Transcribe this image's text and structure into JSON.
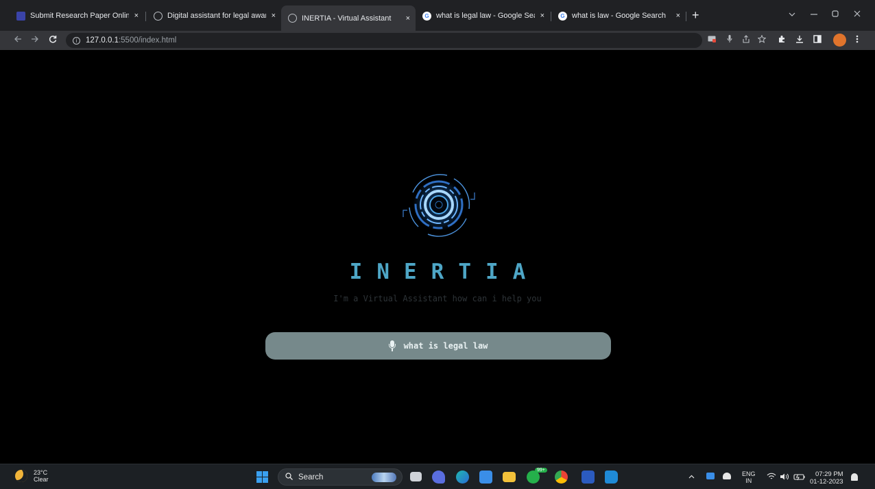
{
  "browser": {
    "tabs": [
      {
        "title": "Submit Research Paper Online -",
        "icon": "paper-icon",
        "active": false
      },
      {
        "title": "Digital assistant for legal awaren",
        "icon": "globe-icon",
        "active": false
      },
      {
        "title": "INERTIA - Virtual Assistant",
        "icon": "globe-icon",
        "active": true
      },
      {
        "title": "what is legal law - Google Searc",
        "icon": "google-icon",
        "active": false
      },
      {
        "title": "what is law - Google Search",
        "icon": "google-icon",
        "active": false
      }
    ],
    "close_glyph": "×",
    "new_tab_glyph": "+",
    "google_glyph": "G",
    "url_host": "127.0.0.1",
    "url_rest": ":5500/index.html",
    "info_glyph": "i"
  },
  "app": {
    "title": "INERTIA",
    "tagline": "I'm a Virtual Assistant how can i help you",
    "query": "what is legal law",
    "accent_color": "#4ea6c6",
    "bar_color": "#76898b"
  },
  "taskbar": {
    "weather_temp": "23°C",
    "weather_desc": "Clear",
    "search_label": "Search",
    "lang_top": "ENG",
    "lang_bottom": "IN",
    "time": "07:29 PM",
    "date": "01-12-2023",
    "badge_chat": "99+"
  }
}
